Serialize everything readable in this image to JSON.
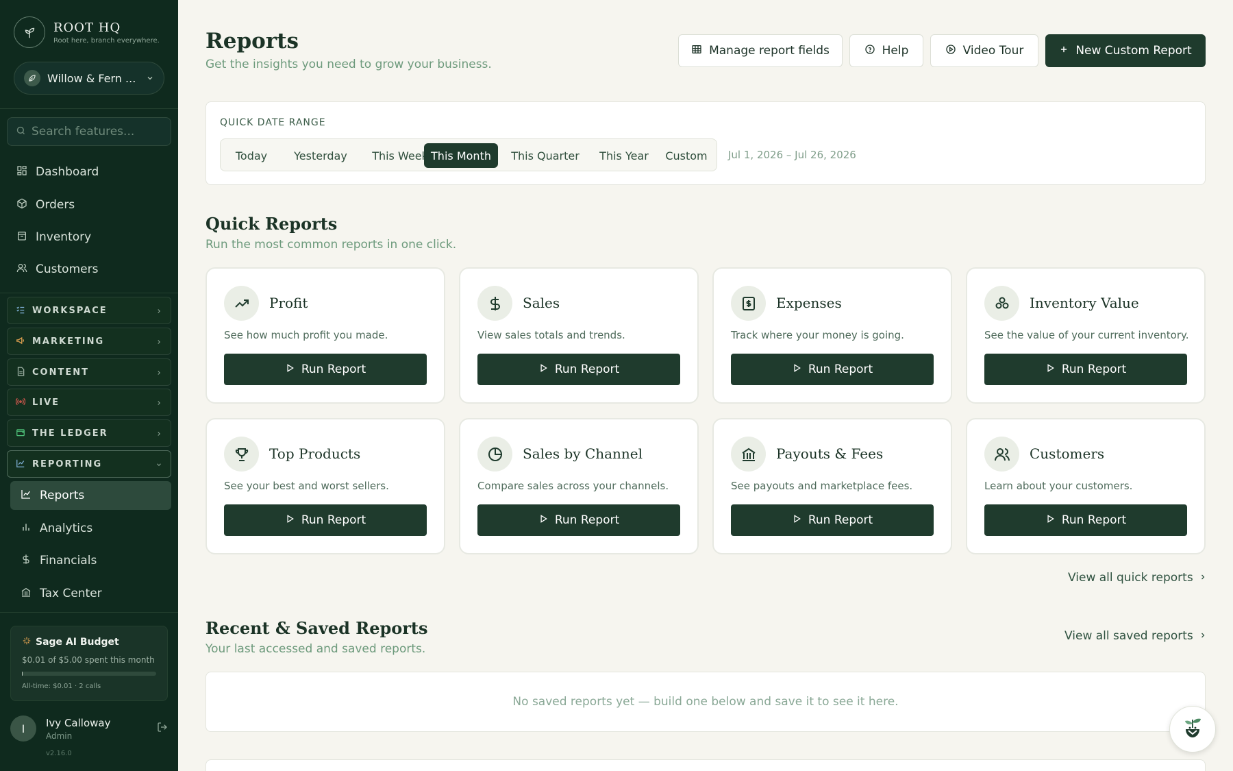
{
  "brand": {
    "name": "ROOT HQ",
    "tagline": "Root here, branch everywhere."
  },
  "store": {
    "name": "Willow & Fern ..."
  },
  "sidebar": {
    "search_placeholder": "Search features...",
    "nav": [
      {
        "label": "Dashboard",
        "icon": "grid-icon"
      },
      {
        "label": "Orders",
        "icon": "box-icon"
      },
      {
        "label": "Inventory",
        "icon": "bag-icon"
      },
      {
        "label": "Customers",
        "icon": "users-icon"
      }
    ],
    "groups": [
      {
        "label": "WORKSPACE",
        "icon": "checklist-icon",
        "icon_color": "#7fb0d6"
      },
      {
        "label": "MARKETING",
        "icon": "megaphone-icon",
        "icon_color": "#e0a050"
      },
      {
        "label": "CONTENT",
        "icon": "document-icon",
        "icon_color": "#9fb3a6"
      },
      {
        "label": "LIVE",
        "icon": "broadcast-icon",
        "icon_color": "#e05a50"
      },
      {
        "label": "THE LEDGER",
        "icon": "wallet-icon",
        "icon_color": "#4fc27a"
      },
      {
        "label": "REPORTING",
        "icon": "chart-icon",
        "icon_color": "#7fb0d6"
      }
    ],
    "reporting_items": [
      {
        "label": "Reports",
        "icon": "line-chart-icon"
      },
      {
        "label": "Analytics",
        "icon": "bar-chart-icon"
      },
      {
        "label": "Financials",
        "icon": "dollar-icon"
      },
      {
        "label": "Tax Center",
        "icon": "bank-icon"
      }
    ],
    "budget": {
      "title": "Sage AI Budget",
      "spent": "$0.01 of $5.00 spent this month",
      "progress": 0.002,
      "all_time": "All-time: $0.01 · 2 calls"
    },
    "user": {
      "initial": "I",
      "name": "Ivy Calloway",
      "role": "Admin"
    },
    "version": "v2.16.0"
  },
  "header": {
    "title": "Reports",
    "subtitle": "Get the insights you need to grow your business.",
    "buttons": {
      "manage": "Manage report fields",
      "help": "Help",
      "tour": "Video Tour",
      "new": "New Custom Report"
    }
  },
  "date_range": {
    "label": "QUICK DATE RANGE",
    "options": [
      "Today",
      "Yesterday",
      "This Week",
      "This Month",
      "This Quarter",
      "This Year",
      "Custom"
    ],
    "selected": "This Month",
    "range_text": "Jul 1, 2026 – Jul 26, 2026"
  },
  "quick_reports": {
    "title": "Quick Reports",
    "subtitle": "Run the most common reports in one click.",
    "run_label": "Run Report",
    "cards": [
      {
        "title": "Profit",
        "desc": "See how much profit you made.",
        "icon": "trending-up-icon"
      },
      {
        "title": "Sales",
        "desc": "View sales totals and trends.",
        "icon": "dollar-icon"
      },
      {
        "title": "Expenses",
        "desc": "Track where your money is going.",
        "icon": "receipt-icon"
      },
      {
        "title": "Inventory Value",
        "desc": "See the value of your current inventory.",
        "icon": "boxes-icon"
      },
      {
        "title": "Top Products",
        "desc": "See your best and worst sellers.",
        "icon": "trophy-icon"
      },
      {
        "title": "Sales by Channel",
        "desc": "Compare sales across your channels.",
        "icon": "pie-chart-icon"
      },
      {
        "title": "Payouts & Fees",
        "desc": "See payouts and marketplace fees.",
        "icon": "bank-icon"
      },
      {
        "title": "Customers",
        "desc": "Learn about your customers.",
        "icon": "users-icon"
      }
    ],
    "view_all": "View all quick reports"
  },
  "saved_reports": {
    "title": "Recent & Saved Reports",
    "subtitle": "Your last accessed and saved reports.",
    "view_all": "View all saved reports",
    "empty_text": "No saved reports yet — build one below and save it to see it here."
  },
  "colors": {
    "sidebar_bg": "#0f2a1e",
    "accent": "#1f3b2d",
    "page_bg": "#f6f5ef",
    "muted_green": "#6d9a7c"
  }
}
